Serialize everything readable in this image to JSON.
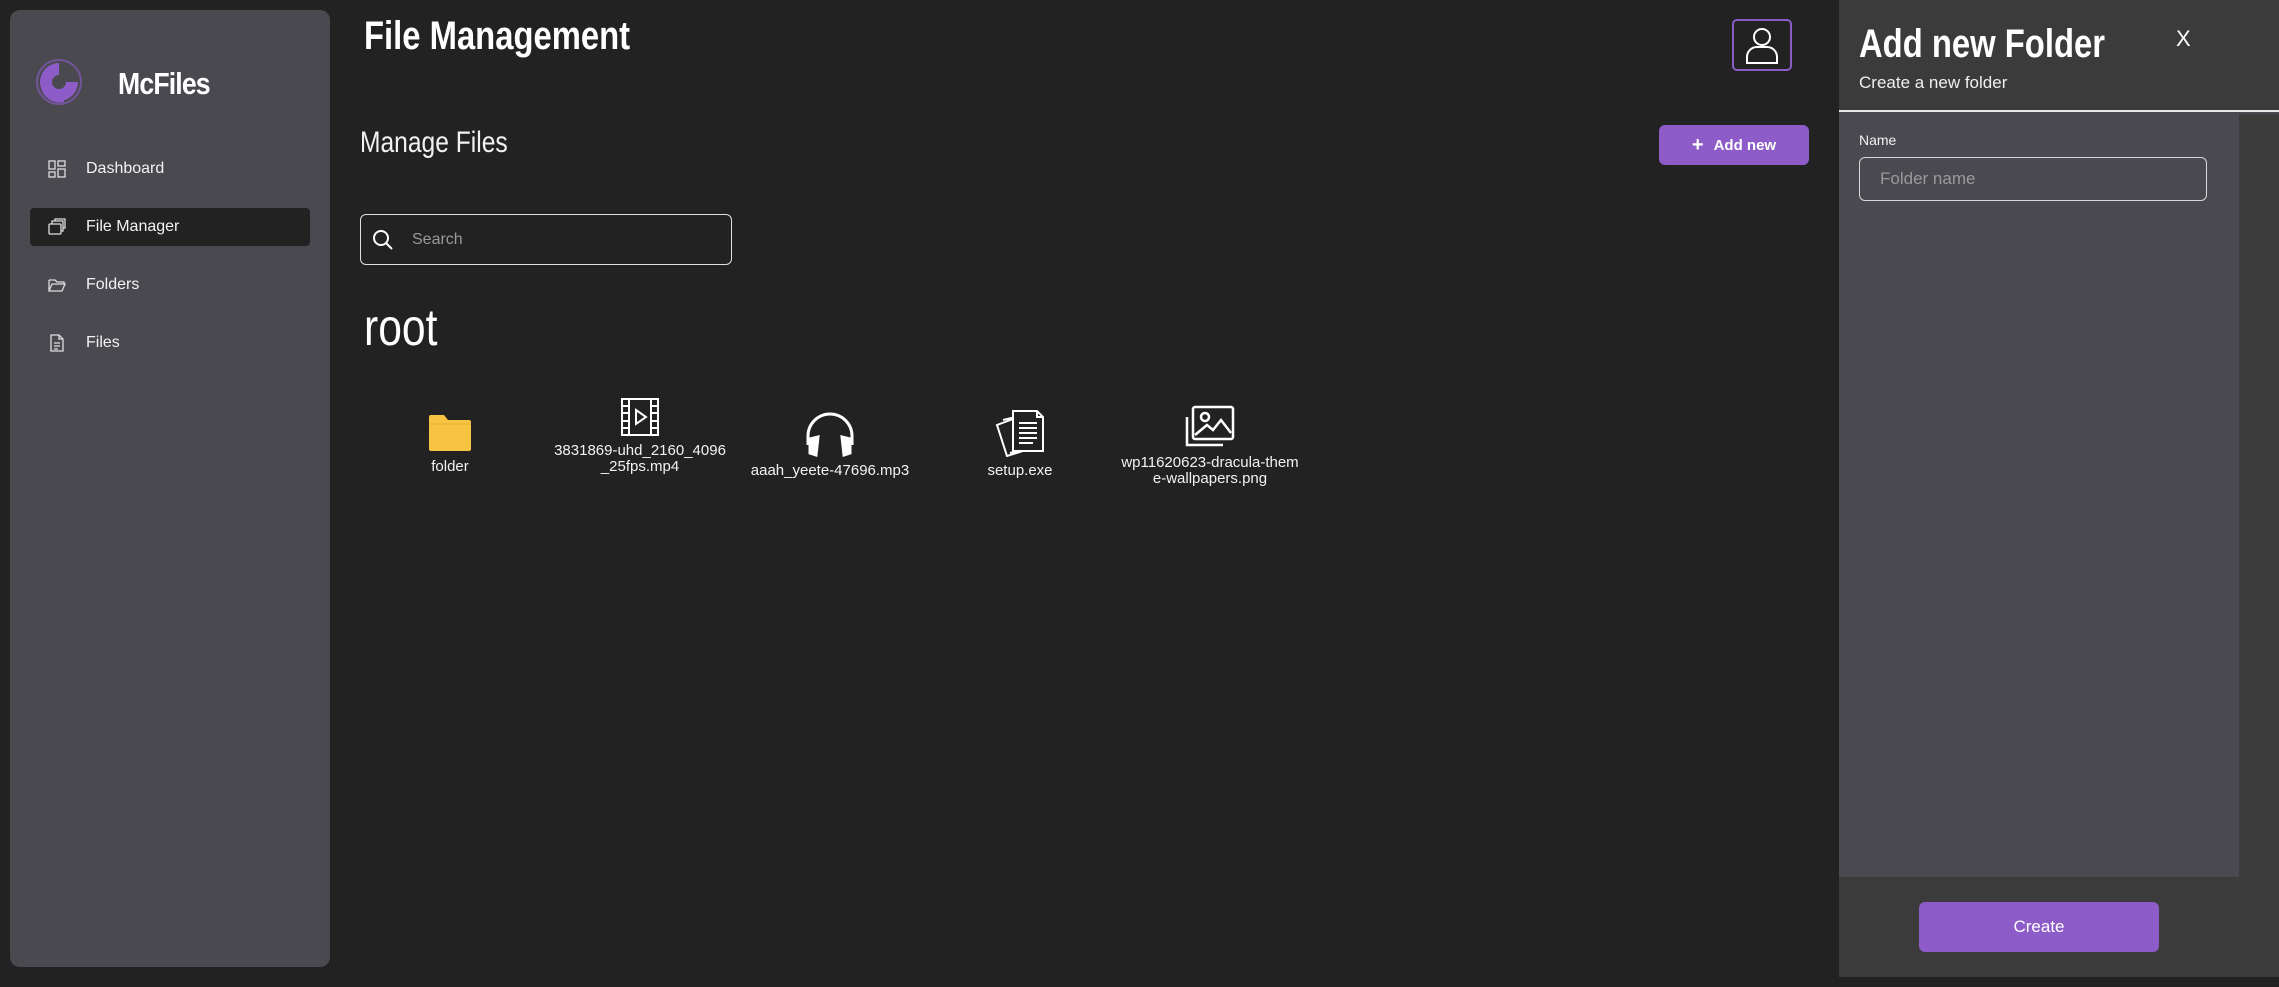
{
  "app": {
    "name": "McFiles",
    "accent": "#8e5cc9"
  },
  "sidebar": {
    "items": [
      {
        "label": "Dashboard",
        "icon": "dashboard-icon"
      },
      {
        "label": "File Manager",
        "icon": "file-manager-icon",
        "active": true
      },
      {
        "label": "Folders",
        "icon": "folder-open-icon"
      },
      {
        "label": "Files",
        "icon": "document-icon"
      }
    ]
  },
  "header": {
    "title": "File Management",
    "user_icon": "user-icon"
  },
  "main": {
    "section_title": "Manage Files",
    "add_label": "Add new",
    "search": {
      "placeholder": "Search",
      "value": ""
    },
    "path_title": "root",
    "files": [
      {
        "name": "folder",
        "icon": "folder-icon"
      },
      {
        "name": "3831869-uhd_2160_4096_25fps.mp4",
        "icon": "video-icon"
      },
      {
        "name": "aaah_yeete-47696.mp3",
        "icon": "headphones-icon"
      },
      {
        "name": "setup.exe",
        "icon": "documents-icon"
      },
      {
        "name": "wp11620623-dracula-theme-wallpapers.png",
        "icon": "image-icon"
      }
    ]
  },
  "panel": {
    "title": "Add new Folder",
    "subtitle": "Create a new folder",
    "close_label": "X",
    "name_label": "Name",
    "name_placeholder": "Folder name",
    "name_value": "",
    "create_label": "Create"
  }
}
